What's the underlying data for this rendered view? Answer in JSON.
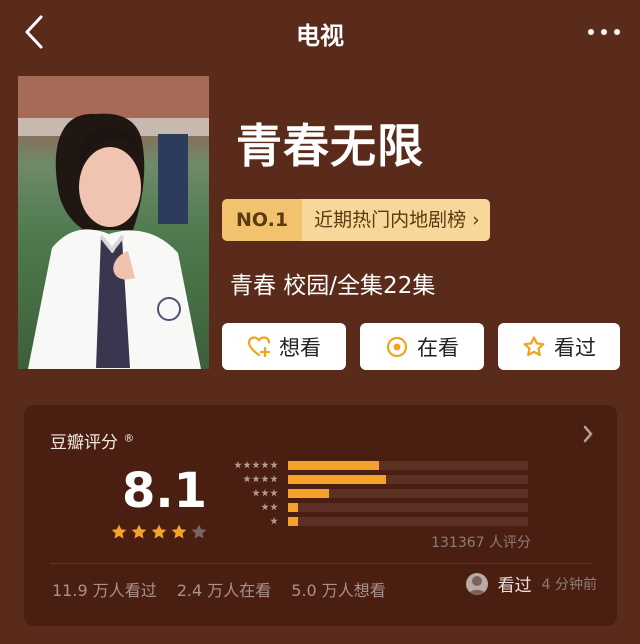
{
  "header": {
    "title": "电视"
  },
  "show": {
    "title": "青春无限",
    "rank_no": "NO.1",
    "rank_name": "近期热门内地剧榜",
    "genre_info": "青春 校园/全集22集"
  },
  "actions": {
    "want": "想看",
    "watching": "在看",
    "watched": "看过"
  },
  "rating": {
    "source": "豆瓣评分",
    "mark": "®",
    "score": "8.1",
    "stars": 4,
    "count": "131367 人评分",
    "distribution": [
      {
        "stars": 5,
        "fraction": 0.38
      },
      {
        "stars": 4,
        "fraction": 0.41
      },
      {
        "stars": 3,
        "fraction": 0.17
      },
      {
        "stars": 2,
        "fraction": 0.04
      },
      {
        "stars": 1,
        "fraction": 0.04
      }
    ]
  },
  "stats": {
    "watched": "11.9 万人看过",
    "watching": "2.4 万人在看",
    "want": "5.0 万人想看"
  },
  "recent": {
    "label": "看过",
    "time": "4 分钟前"
  },
  "colors": {
    "background": "#5a2a1a",
    "card": "#4a1f12",
    "accent": "#f4a22a",
    "badge": "#f3c26e"
  }
}
